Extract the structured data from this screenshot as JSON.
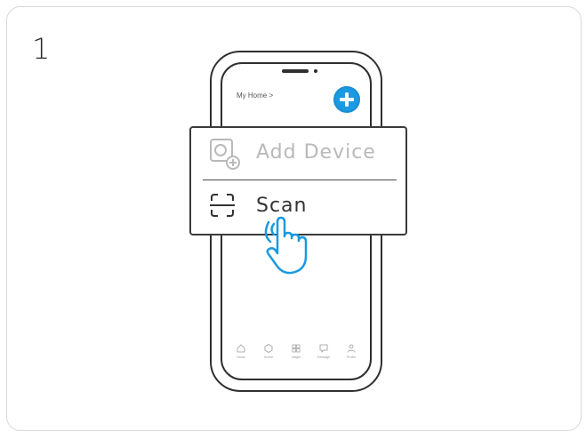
{
  "step": {
    "number": "1"
  },
  "phone": {
    "header": {
      "title": "My Home >"
    },
    "tabbar": {
      "items": [
        {
          "label": "Home",
          "icon": "home-icon"
        },
        {
          "label": "Scene",
          "icon": "scene-icon"
        },
        {
          "label": "Insight",
          "icon": "insight-icon"
        },
        {
          "label": "Message",
          "icon": "message-icon"
        },
        {
          "label": "Profile",
          "icon": "profile-icon"
        }
      ]
    }
  },
  "menu": {
    "items": [
      {
        "label": "Add Device",
        "icon": "add-device-icon",
        "state": "disabled"
      },
      {
        "label": "Scan",
        "icon": "scan-icon",
        "state": "active"
      }
    ]
  },
  "colors": {
    "accent": "#1a9ae0",
    "outline": "#2f2f2f",
    "disabled": "#b9b9b9"
  }
}
